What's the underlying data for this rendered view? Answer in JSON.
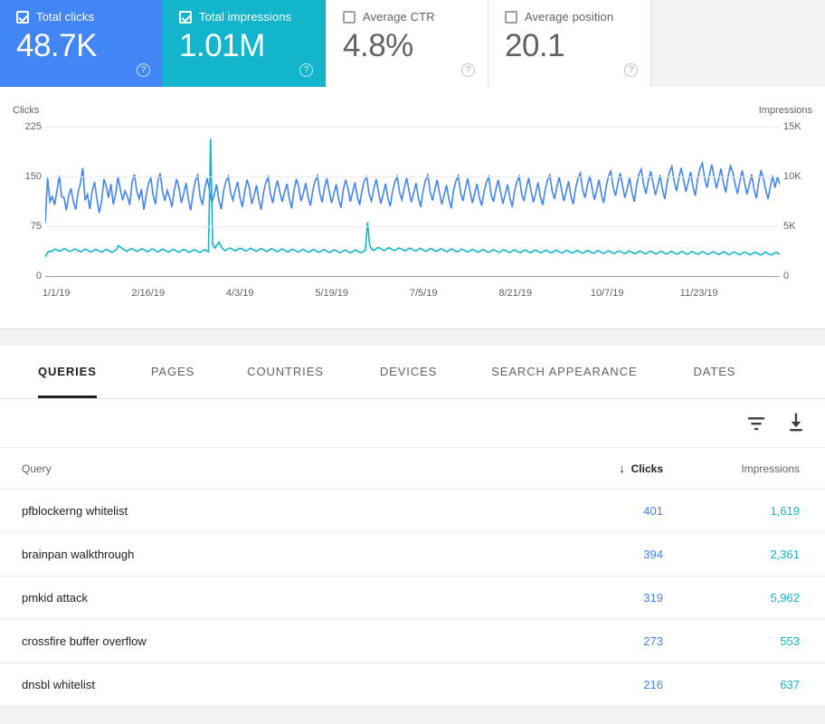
{
  "metric_cards": [
    {
      "label": "Total clicks",
      "value": "48.7K",
      "checked": true,
      "state": "selected-blue",
      "help_icon": "help-circle-icon",
      "accent": "#4285f4"
    },
    {
      "label": "Total impressions",
      "value": "1.01M",
      "checked": true,
      "state": "selected-teal",
      "help_icon": "help-circle-icon",
      "accent": "#12b5cb"
    },
    {
      "label": "Average CTR",
      "value": "4.8%",
      "checked": false,
      "state": "unselected",
      "help_icon": "help-circle-icon",
      "accent": "#5f6368"
    },
    {
      "label": "Average position",
      "value": "20.1",
      "checked": false,
      "state": "unselected",
      "help_icon": "help-circle-icon",
      "accent": "#5f6368"
    }
  ],
  "chart_data": {
    "type": "line",
    "title": "",
    "xlabel": "",
    "ylabel": "Clicks",
    "y2label": "Impressions",
    "grid": true,
    "legend": "none",
    "left_axis": {
      "label": "Clicks",
      "ticks": [
        "0",
        "75",
        "150",
        "225"
      ],
      "min": 0,
      "max": 225
    },
    "right_axis": {
      "label": "Impressions",
      "ticks": [
        "0",
        "5K",
        "10K",
        "15K"
      ],
      "min": 0,
      "max": 15000
    },
    "x_tick_labels": [
      "1/1/19",
      "2/16/19",
      "4/3/19",
      "5/19/19",
      "7/5/19",
      "8/21/19",
      "10/7/19",
      "11/23/19"
    ],
    "series": [
      {
        "name": "Clicks",
        "color": "#4285f4",
        "axis": "left",
        "values": [
          80,
          148,
          112,
          120,
          107,
          129,
          151,
          119,
          118,
          99,
          121,
          132,
          112,
          100,
          126,
          140,
          163,
          114,
          123,
          101,
          128,
          142,
          117,
          95,
          112,
          146,
          135,
          118,
          139,
          108,
          123,
          149,
          131,
          114,
          128,
          120,
          107,
          142,
          153,
          128,
          116,
          131,
          100,
          121,
          139,
          148,
          122,
          108,
          143,
          155,
          127,
          113,
          129,
          118,
          104,
          130,
          146,
          133,
          110,
          124,
          140,
          116,
          99,
          125,
          144,
          152,
          120,
          107,
          132,
          147,
          129,
          111,
          122,
          138,
          114,
          101,
          128,
          143,
          150,
          126,
          114,
          130,
          142,
          118,
          104,
          127,
          145,
          133,
          109,
          121,
          137,
          115,
          100,
          126,
          141,
          149,
          123,
          110,
          131,
          144,
          126,
          112,
          127,
          139,
          117,
          102,
          129,
          146,
          134,
          113,
          125,
          140,
          119,
          106,
          128,
          143,
          151,
          125,
          111,
          133,
          147,
          128,
          110,
          124,
          138,
          116,
          103,
          130,
          145,
          132,
          112,
          126,
          141,
          120,
          107,
          129,
          144,
          149,
          124,
          113,
          131,
          146,
          127,
          109,
          123,
          139,
          117,
          105,
          127,
          142,
          150,
          126,
          115,
          132,
          148,
          129,
          111,
          125,
          140,
          118,
          104,
          128,
          144,
          152,
          127,
          114,
          130,
          145,
          126,
          108,
          122,
          137,
          116,
          102,
          129,
          143,
          151,
          125,
          113,
          131,
          147,
          128,
          110,
          124,
          139,
          118,
          106,
          127,
          141,
          149,
          123,
          112,
          130,
          145,
          127,
          109,
          123,
          138,
          117,
          104,
          128,
          142,
          150,
          124,
          113,
          132,
          148,
          129,
          111,
          125,
          141,
          119,
          107,
          130,
          144,
          152,
          128,
          116,
          134,
          149,
          131,
          113,
          127,
          143,
          121,
          108,
          132,
          147,
          155,
          130,
          118,
          136,
          151,
          133,
          115,
          129,
          145,
          123,
          110,
          134,
          150,
          158,
          134,
          121,
          139,
          155,
          136,
          118,
          132,
          148,
          126,
          112,
          137,
          153,
          161,
          138,
          124,
          143,
          158,
          140,
          122,
          136,
          152,
          130,
          116,
          141,
          157,
          165,
          142,
          128,
          147,
          163,
          145,
          127,
          141,
          157,
          135,
          121,
          146,
          162,
          170,
          147,
          133,
          152,
          168,
          150,
          132,
          146,
          162,
          140,
          126,
          150,
          166,
          156,
          138,
          124,
          143,
          159,
          141,
          123,
          137,
          153,
          131,
          117,
          142,
          158,
          148,
          130,
          116,
          135,
          151,
          133,
          150,
          138
        ]
      },
      {
        "name": "Impressions",
        "color": "#12b5cb",
        "axis": "right",
        "values": [
          1900,
          2350,
          2500,
          2450,
          2620,
          2700,
          2560,
          2480,
          2610,
          2750,
          2680,
          2540,
          2460,
          2590,
          2720,
          2650,
          2510,
          2440,
          2570,
          2700,
          2630,
          2490,
          2420,
          2550,
          2690,
          2610,
          2470,
          2400,
          2530,
          2670,
          2600,
          2460,
          2390,
          2520,
          2660,
          3050,
          2900,
          2750,
          2600,
          2480,
          2620,
          2760,
          2690,
          2550,
          2470,
          2600,
          2740,
          2670,
          2530,
          2450,
          2580,
          2720,
          2650,
          2510,
          2430,
          2560,
          2700,
          2630,
          2490,
          2410,
          2540,
          2680,
          2610,
          2470,
          2400,
          2530,
          2670,
          2600,
          2460,
          2380,
          2510,
          2650,
          2580,
          2440,
          2370,
          2500,
          2640,
          2570,
          2430,
          13800,
          3200,
          2800,
          3100,
          3400,
          3000,
          2700,
          2550,
          2680,
          2820,
          2750,
          2610,
          2530,
          2660,
          2800,
          2730,
          2590,
          2510,
          2640,
          2780,
          2710,
          2570,
          2490,
          2620,
          2760,
          2690,
          2550,
          2470,
          2600,
          2740,
          2670,
          2530,
          2450,
          2580,
          2720,
          2650,
          2510,
          2430,
          2560,
          2700,
          2630,
          2490,
          2410,
          2540,
          2680,
          2610,
          2470,
          2390,
          2520,
          2660,
          2590,
          2450,
          2380,
          2510,
          2650,
          2580,
          2440,
          2360,
          2490,
          2630,
          2560,
          2420,
          2350,
          2480,
          2620,
          2550,
          2410,
          2340,
          2470,
          2610,
          2540,
          2400,
          2330,
          2460,
          2600,
          5400,
          3100,
          2700,
          2580,
          2720,
          2860,
          2790,
          2650,
          2570,
          2700,
          2840,
          2770,
          2630,
          2550,
          2680,
          2820,
          2750,
          2610,
          2530,
          2660,
          2800,
          2730,
          2590,
          2510,
          2640,
          2780,
          2710,
          2570,
          2490,
          2620,
          2760,
          2690,
          2550,
          2470,
          2600,
          2740,
          2670,
          2530,
          2450,
          2580,
          2720,
          2650,
          2510,
          2430,
          2560,
          2700,
          2630,
          2490,
          2410,
          2540,
          2680,
          2610,
          2470,
          2390,
          2520,
          2660,
          2590,
          2450,
          2380,
          2510,
          2650,
          2580,
          2440,
          2370,
          2500,
          2640,
          2570,
          2430,
          2360,
          2490,
          2630,
          2560,
          2420,
          2350,
          2480,
          2620,
          2550,
          2410,
          2340,
          2470,
          2610,
          2540,
          2400,
          2330,
          2460,
          2600,
          2530,
          2390,
          2320,
          2450,
          2590,
          2520,
          2380,
          2310,
          2440,
          2580,
          2510,
          2370,
          2300,
          2430,
          2570,
          2500,
          2360,
          2290,
          2420,
          2560,
          2490,
          2350,
          2280,
          2410,
          2550,
          2480,
          2340,
          2270,
          2400,
          2540,
          2470,
          2330,
          2260,
          2390,
          2530,
          2460,
          2320,
          2250,
          2380,
          2520,
          2450,
          2310,
          2240,
          2370,
          2510,
          2440,
          2300,
          2230,
          2360,
          2500,
          2430,
          2290,
          2220,
          2350,
          2490,
          2420,
          2280,
          2210,
          2340,
          2480,
          2410,
          2270,
          2200,
          2330,
          2470,
          2400,
          2260,
          2190,
          2320,
          2460,
          2390,
          2250,
          2180,
          2310,
          2450,
          2380,
          2240,
          2170,
          2300,
          2440,
          2370,
          2230,
          2160,
          2290,
          2430,
          2360,
          2220,
          2150,
          2280,
          2420,
          2350,
          2210,
          2140,
          2270,
          2410,
          2340,
          2200,
          2130,
          2260,
          2400,
          2330,
          2190,
          2120,
          2250,
          2390,
          2320,
          2180,
          2110,
          2240,
          2380,
          2310,
          2170
        ]
      }
    ]
  },
  "tabs": [
    {
      "label": "QUERIES",
      "active": true
    },
    {
      "label": "PAGES",
      "active": false
    },
    {
      "label": "COUNTRIES",
      "active": false
    },
    {
      "label": "DEVICES",
      "active": false
    },
    {
      "label": "SEARCH APPEARANCE",
      "active": false
    },
    {
      "label": "DATES",
      "active": false
    }
  ],
  "toolbar": {
    "filter_icon": "filter-icon",
    "download_icon": "download-icon"
  },
  "table": {
    "columns": {
      "query": "Query",
      "clicks": "Clicks",
      "impressions": "Impressions"
    },
    "sort": {
      "column": "clicks",
      "direction": "desc",
      "glyph": "↓"
    },
    "rows": [
      {
        "query": "pfblockerng whitelist",
        "clicks": "401",
        "impressions": "1,619"
      },
      {
        "query": "brainpan walkthrough",
        "clicks": "394",
        "impressions": "2,361"
      },
      {
        "query": "pmkid attack",
        "clicks": "319",
        "impressions": "5,962"
      },
      {
        "query": "crossfire buffer overflow",
        "clicks": "273",
        "impressions": "553"
      },
      {
        "query": "dnsbl whitelist",
        "clicks": "216",
        "impressions": "637"
      }
    ]
  },
  "colors": {
    "clicks": "#4285f4",
    "impressions": "#12b5cb",
    "text_primary": "#202124",
    "text_secondary": "#5f6368",
    "page_bg": "#f1f3f4"
  }
}
